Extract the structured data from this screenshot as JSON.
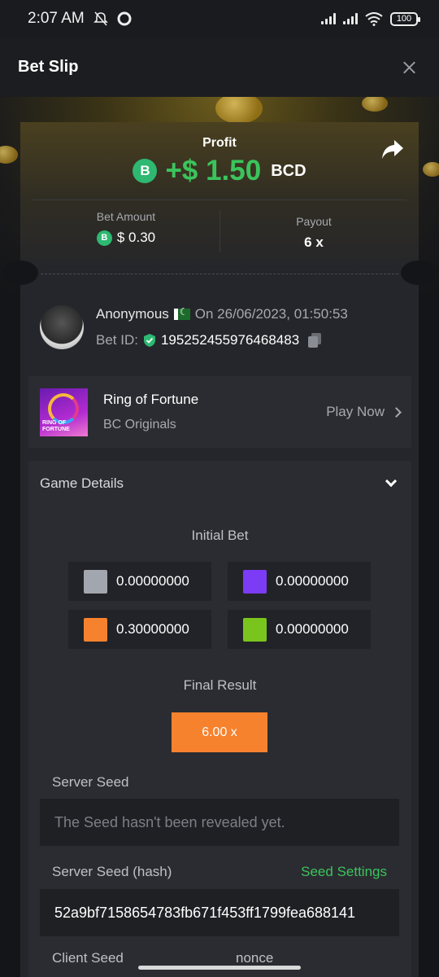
{
  "status_bar": {
    "time": "2:07 AM",
    "battery": "100"
  },
  "header": {
    "title": "Bet Slip"
  },
  "profit": {
    "label": "Profit",
    "value": "+$ 1.50",
    "currency": "BCD",
    "coin_symbol": "B"
  },
  "stats": {
    "bet_amount_label": "Bet Amount",
    "bet_amount_value": "$ 0.30",
    "payout_label": "Payout",
    "payout_value": "6 x"
  },
  "user": {
    "name": "Anonymous",
    "date": "On 26/06/2023, 01:50:53",
    "bet_id_label": "Bet ID:",
    "bet_id": "195252455976468483"
  },
  "game": {
    "name": "Ring of Fortune",
    "provider": "BC Originals",
    "play_label": "Play Now",
    "thumb_text": "RING OF FORTUNE"
  },
  "details": {
    "title": "Game Details",
    "initial_bet_label": "Initial Bet",
    "bets": [
      {
        "color": "#a2a6ae",
        "value": "0.00000000"
      },
      {
        "color": "#7c3cf6",
        "value": "0.00000000"
      },
      {
        "color": "#f7822e",
        "value": "0.30000000"
      },
      {
        "color": "#7ac51d",
        "value": "0.00000000"
      }
    ],
    "final_result_label": "Final Result",
    "final_result_value": "6.00 x",
    "server_seed_label": "Server Seed",
    "server_seed_value": "The Seed hasn't been revealed yet.",
    "server_seed_hash_label": "Server Seed (hash)",
    "seed_settings_label": "Seed Settings",
    "server_seed_hash_value": "52a9bf7158654783fb671f453ff1799fea688141",
    "client_seed_label": "Client Seed",
    "nonce_label": "nonce"
  },
  "colors": {
    "accent_green": "#3bc45c",
    "accent_orange": "#f7822e"
  }
}
